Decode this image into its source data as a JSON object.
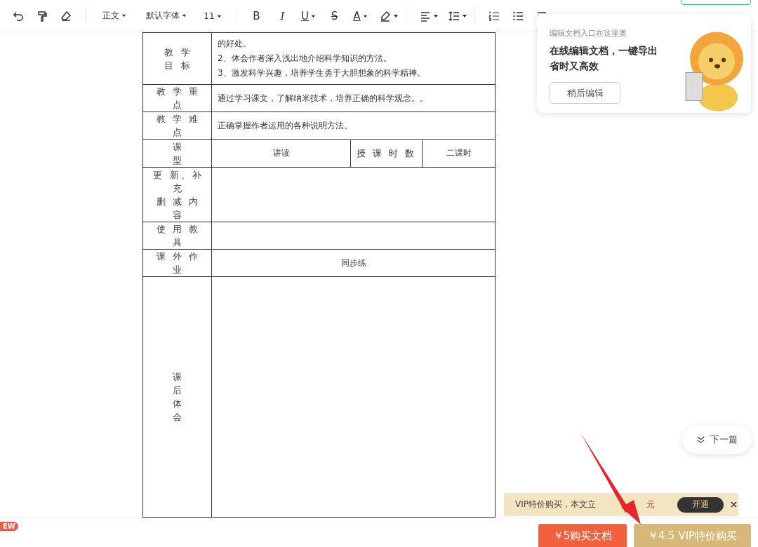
{
  "toolbar": {
    "paragraph_style": "正文",
    "font": "默认字体",
    "font_size": "11",
    "format_buttons": [
      {
        "label": "B",
        "kind": "bold",
        "dropdown": false
      },
      {
        "label": "I",
        "kind": "italic",
        "dropdown": false
      },
      {
        "label": "U",
        "kind": "underline",
        "dropdown": true
      },
      {
        "label": "S",
        "kind": "strike",
        "dropdown": false
      },
      {
        "label": "A",
        "kind": "color",
        "dropdown": true
      }
    ]
  },
  "table": {
    "rows": [
      {
        "kind": "lines",
        "label": [
          "教 学",
          "目 标"
        ],
        "lines": [
          "的好处。",
          "2、体会作者深入浅出地介绍科学知识的方法。",
          "3、激发科学兴趣，培养学生勇于大胆想象的科学精神。"
        ]
      },
      {
        "kind": "lines",
        "label": [
          "教 学 重",
          "点"
        ],
        "lines": [
          "通过学习课文，了解纳米技术，培养正确的科学观念。。"
        ]
      },
      {
        "kind": "lines",
        "label": [
          "教 学 难",
          "点"
        ],
        "lines": [
          "正确掌握作者运用的各种说明方法。"
        ]
      },
      {
        "kind": "split",
        "label": [
          "课",
          "型"
        ],
        "cells": [
          "讲读",
          "授 课 时 数",
          "二课时"
        ]
      },
      {
        "kind": "blank",
        "label": [
          "更 新、补",
          "充",
          "删 减 内",
          "容"
        ]
      },
      {
        "kind": "blank",
        "label": [
          "使 用 教",
          "具"
        ]
      },
      {
        "kind": "center",
        "label": [
          "课 外 作",
          "业"
        ],
        "lines": [
          "同步练"
        ]
      },
      {
        "kind": "tall",
        "label": [
          "课",
          "后",
          "体",
          "会"
        ]
      }
    ]
  },
  "tooltip": {
    "hint": "编辑文档入口在这里奥",
    "headline": [
      "在线编辑文档，一键导出",
      "省时又高效"
    ],
    "button": "稍后编辑"
  },
  "next_button": "下一篇",
  "vip_banner": {
    "text": "VIP特价购买，本文立",
    "price": "元",
    "button": "开通"
  },
  "new_badge": "EW",
  "buy_buttons": [
    {
      "label": "￥5购买文档",
      "kind": "buy"
    },
    {
      "label": "￥4.5 VIP特价购买",
      "kind": "vip"
    }
  ]
}
